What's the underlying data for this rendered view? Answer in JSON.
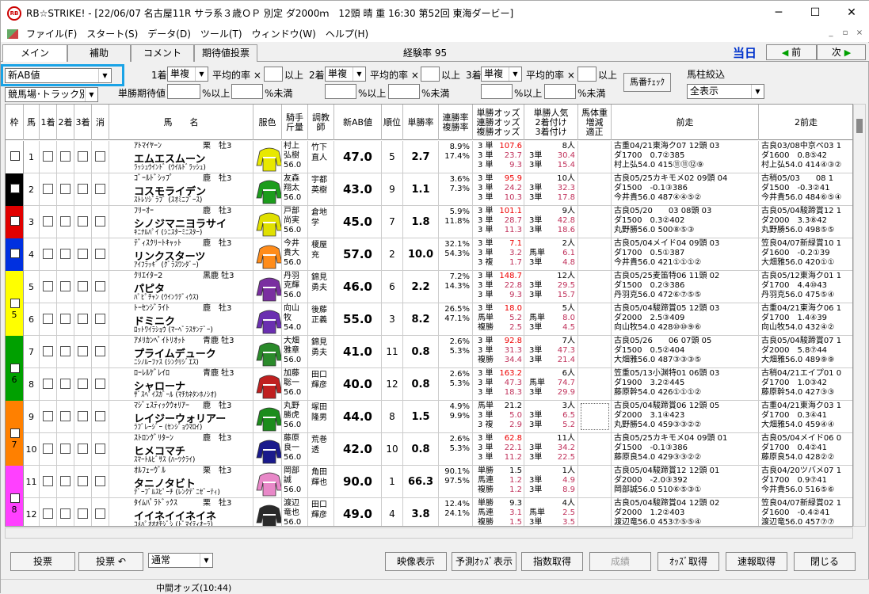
{
  "titlebar": {
    "title": "RB☆STRIKE! - [22/06/07 名古屋11R サラ系３歳ＯＰ 別定 ダ2000ｍ　12頭 晴 重 16:30 第52回 東海ダービー]",
    "minimize": "─",
    "maximize": "☐",
    "close": "✕",
    "icon": "RB"
  },
  "menu": [
    "ファイル(F)",
    "スタート(S)",
    "データ(D)",
    "ツール(T)",
    "ウィンドウ(W)",
    "ヘルプ(H)"
  ],
  "mdi": {
    "min": "_",
    "restore": "▫",
    "close": "×"
  },
  "tabs": [
    "メイン",
    "補助",
    "コメント",
    "期待値投票"
  ],
  "experience": "経験率 95",
  "today": "当日",
  "prev": "前",
  "next": "次",
  "controls": {
    "index": "新AB値",
    "venue": "競馬場･トラック別",
    "place1": "1着",
    "place2": "2着",
    "place3": "3着",
    "bet": "単複",
    "avg": "平均的率 ×",
    "above": "以上",
    "expect": "単勝期待値",
    "pct_above": "%以上",
    "pct_below": "%未満",
    "check_btn": "馬番ﾁｪｯｸ",
    "filter_label": "馬柱絞込",
    "filter": "全表示"
  },
  "columns": {
    "waku": "枠",
    "uma": "馬",
    "c1": "1着",
    "c2": "2着",
    "c3": "3着",
    "kesu": "消",
    "name": "馬　　名",
    "color": "服色",
    "jockey": "騎手\n斤量",
    "trainer": "調教\n師",
    "ab": "新AB値",
    "rank": "順位",
    "tan": "単勝率",
    "rate": "連勝率\n複勝率",
    "odds": "単勝オッズ\n連勝オッズ\n複勝オッズ",
    "pop": "単勝人気\n2着付け\n3着付け",
    "weight": "馬体重\n増減\n適正",
    "prev1": "前走",
    "prev2": "2前走"
  },
  "horses": [
    {
      "waku": "1",
      "no": "1",
      "sire": "ｱﾄﾏｲﾔｰﾝ",
      "sex": "栗　牡3",
      "name": "エムエスムーン",
      "dam": "ﾗｯｼｭｳｲﾝﾄﾞ (ｳｲﾙﾄﾞﾗｯｼｭ)",
      "j1": "村上",
      "j2": "弘樹",
      "wt": "56.0",
      "t1": "竹下",
      "t2": "直人",
      "ab": "47.0",
      "rank": "5",
      "tan": "2.7",
      "r1": "8.9%",
      "r2": "17.4%",
      "o1": "3 単",
      "o1v": "107.6",
      "o2": "3 単",
      "o2v": "23.7",
      "o3": "3 単",
      "o3v": "9.3",
      "p1": "8人",
      "p2l": "3単",
      "p2": "30.4",
      "p3l": "3単",
      "p3": "15.4",
      "pr1": "古重04/21東海ク07 12頭 03",
      "pr2": "ダ1700　0.7②385",
      "pr3": "村上弘54.0 415⑪⑪⑫⑨",
      "pp1": "古良03/08中京ペ03 1",
      "pp2": "ダ1600　0.8⑤42",
      "pp3": "村上弘54.0 414④③②"
    },
    {
      "waku": "2",
      "no": "2",
      "sire": "ｺﾞｰﾙﾄﾞｼｯﾌﾟ",
      "sex": "鹿　牡3",
      "name": "コスモライデン",
      "dam": "ｽﾄﾚｿｼﾞﾗﾌﾞ (ｽｵﾐﾆﾌﾞｰｽ)",
      "j1": "友森",
      "j2": "翔太",
      "wt": "56.0",
      "t1": "宇都",
      "t2": "英樹",
      "ab": "43.0",
      "rank": "9",
      "tan": "1.1",
      "r1": "3.6%",
      "r2": "7.3%",
      "o1": "3 単",
      "o1v": "95.9",
      "o2": "3 単",
      "o2v": "24.2",
      "o3": "3 単",
      "o3v": "10.3",
      "p1": "10人",
      "p2l": "3単",
      "p2": "32.3",
      "p3l": "3単",
      "p3": "17.8",
      "pr1": "古良05/25カキモメ02 09頭 04",
      "pr2": "ダ1500　-0.1③386",
      "pr3": "今井貴56.0 487④④⑤②",
      "pp1": "古稍05/03　　08 1",
      "pp2": "ダ1500　-0.3②41",
      "pp3": "今井貴56.0 484⑥⑤④"
    },
    {
      "waku": "3",
      "no": "3",
      "sire": "ﾌﾘｰｵｰ",
      "sex": "鹿　牡3",
      "name": "シノジマニヨラサイ",
      "dam": "ｷﾆﾅﾙﾊﾟｲ (ｼﾆｽﾀｰﾐﾆｽﾀｰ)",
      "j1": "戸部",
      "j2": "尚実",
      "wt": "56.0",
      "t1": "倉地",
      "t2": "学",
      "ab": "45.0",
      "rank": "7",
      "tan": "1.8",
      "r1": "5.9%",
      "r2": "11.8%",
      "o1": "3 単",
      "o1v": "101.1",
      "o2": "3 単",
      "o2v": "28.7",
      "o3": "3 単",
      "o3v": "11.3",
      "p1": "9人",
      "p2l": "3単",
      "p2": "42.8",
      "p3l": "3単",
      "p3": "18.6",
      "pr1": "古良05/20　　03 08頭 03",
      "pr2": "ダ1500　0.3②402",
      "pr3": "丸野勝56.0 500⑧⑤③",
      "pp1": "古良05/04駿蹄賞12 1",
      "pp2": "ダ2000　3.3⑧42",
      "pp3": "丸野勝56.0 498⑤⑤"
    },
    {
      "waku": "4",
      "no": "4",
      "sire": "ﾃﾞｨｽｸﾘｰﾄｷｬｯﾄ",
      "sex": "鹿　牡3",
      "name": "リンクスターツ",
      "dam": "ｱｲﾌﾗｯｷﾞ (ｸﾞﾗｽﾜﾝﾀﾞｰ)",
      "j1": "今井",
      "j2": "貴大",
      "wt": "56.0",
      "t1": "榎屋",
      "t2": "充",
      "ab": "57.0",
      "rank": "2",
      "tan": "10.0",
      "r1": "32.1%",
      "r2": "54.3%",
      "o1": "3 単",
      "o1v": "7.1",
      "o2": "3 単",
      "o2v": "3.2",
      "o3": "3 複",
      "o3v": "1.7",
      "p1": "2人",
      "p2l": "馬単",
      "p2": "6.1",
      "p3l": "3単",
      "p3": "4.8",
      "pr1": "古良05/04メイド04 09頭 03",
      "pr2": "ダ1700　0.5①387",
      "pr3": "今井貴56.0 421①①①②",
      "pp1": "笠良04/07新緑賞10 1",
      "pp2": "ダ1600　-0.2①39",
      "pp3": "大畑雅56.0 420①①"
    },
    {
      "waku": "5",
      "no": "5",
      "sire": "ｸﾘｴｲﾀｰ2",
      "sex": "黒鹿 牡3",
      "name": "パピタ",
      "dam": "ﾊﾟﾋﾟﾁｬﾝ (ｳｲﾝﾗﾃﾞｨｳｽ)",
      "j1": "丹羽",
      "j2": "克輝",
      "wt": "56.0",
      "t1": "錦見",
      "t2": "勇夫",
      "ab": "46.0",
      "rank": "6",
      "tan": "2.2",
      "r1": "7.2%",
      "r2": "14.3%",
      "o1": "3 単",
      "o1v": "148.7",
      "o2": "3 単",
      "o2v": "22.8",
      "o3": "3 単",
      "o3v": "9.3",
      "p1": "12人",
      "p2l": "3単",
      "p2": "29.5",
      "p3l": "3単",
      "p3": "15.7",
      "pr1": "古良05/25麦笛特06 11頭 02",
      "pr2": "ダ1500　0.2③386",
      "pr3": "丹羽克56.0 472⑥⑦⑤⑤",
      "pp1": "古良05/12東海ク01 1",
      "pp2": "ダ1700　4.4⑩43",
      "pp3": "丹羽克56.0 475⑤④"
    },
    {
      "waku": "5",
      "no": "6",
      "sire": "ﾄｰｾﾝｼﾞﾗｲﾄ",
      "sex": "鹿　牡3",
      "name": "ドミニク",
      "dam": "ﾛｯﾄﾜｲﾗｼｮｳ (ﾏｰﾍﾞﾗｽｻﾝﾃﾞｰ)",
      "j1": "向山",
      "j2": "牧",
      "wt": "54.0",
      "t1": "後藤",
      "t2": "正義",
      "ab": "55.0",
      "rank": "3",
      "tan": "8.2",
      "r1": "26.5%",
      "r2": "47.1%",
      "o1": "3 単",
      "o1v": "18.0",
      "o2": "馬単",
      "o2v": "5.2",
      "o3": "複勝",
      "o3v": "2.5",
      "p1": "5人",
      "p2l": "馬単",
      "p2": "8.0",
      "p3l": "3単",
      "p3": "4.5",
      "pr1": "古良05/04駿蹄賞05 12頭 03",
      "pr2": "ダ2000　2.5③409",
      "pr3": "向山牧54.0 428⑩⑩⑨⑥",
      "pp1": "古重04/21東海ク06 1",
      "pp2": "ダ1700　1.4④39",
      "pp3": "向山牧54.0 432④②"
    },
    {
      "waku": "6",
      "no": "7",
      "sire": "ｱﾒﾘｶﾝﾍﾟｲﾄﾘｵｯﾄ",
      "sex": "青鹿 牡3",
      "name": "プライムデューク",
      "dam": "ﾆｼﾉﾙｰﾌｧｽ (ｼﾝｸﾘｼﾞｴｽ)",
      "j1": "大畑",
      "j2": "雅章",
      "wt": "56.0",
      "t1": "錦見",
      "t2": "勇夫",
      "ab": "41.0",
      "rank": "11",
      "tan": "0.8",
      "r1": "2.6%",
      "r2": "5.3%",
      "o1": "3 単",
      "o1v": "92.8",
      "o2": "3 単",
      "o2v": "31.3",
      "o3": "複勝",
      "o3v": "34.4",
      "p1": "7人",
      "p2l": "3単",
      "p2": "47.3",
      "p3l": "3単",
      "p3": "21.4",
      "pr1": "古良05/26　　06 07頭 05",
      "pr2": "ダ1500　0.5②404",
      "pr3": "大畑雅56.0 487③③③⑤",
      "pp1": "古良05/04駿蹄賞07 1",
      "pp2": "ダ2000　5.8⑦44",
      "pp3": "大畑雅56.0 489⑨⑨"
    },
    {
      "waku": "6",
      "no": "8",
      "sire": "ﾛｰﾚﾙｹﾞﾚｲﾛ",
      "sex": "青鹿 牡3",
      "name": "シャローナ",
      "dam": "ｻﾞｽﾍﾟｲｽｶﾞｰﾙ (ﾏﾁｶﾈﾀﾝﾎﾉｼｵ)",
      "j1": "加藤",
      "j2": "聡一",
      "wt": "56.0",
      "t1": "田口",
      "t2": "輝彦",
      "ab": "40.0",
      "rank": "12",
      "tan": "0.8",
      "r1": "2.6%",
      "r2": "5.3%",
      "o1": "3 単",
      "o1v": "163.2",
      "o2": "3 単",
      "o2v": "47.3",
      "o3": "3 単",
      "o3v": "18.3",
      "p1": "6人",
      "p2l": "馬単",
      "p2": "74.7",
      "p3l": "3単",
      "p3": "29.9",
      "pr1": "笠重05/13小渊特01 06頭 03",
      "pr2": "ダ1900　3.2②445",
      "pr3": "藤原幹54.0 426①①①②",
      "pp1": "古稍04/21エイプ01 0",
      "pp2": "ダ1700　1.0③42",
      "pp3": "藤原幹54.0 427③③"
    },
    {
      "waku": "7",
      "no": "9",
      "sire": "ﾏｼﾞｪｽﾃｨｯｸｳｫﾘｱｰ",
      "sex": "鹿　牡3",
      "name": "レイジーウォリアー",
      "dam": "ﾗﾌﾞﾚｰｼﾞｰ (ｾﾝｼﾞｮｳﾏﾛｲ)",
      "j1": "丸野",
      "j2": "勝虎",
      "wt": "56.0",
      "t1": "塚田",
      "t2": "隆男",
      "ab": "44.0",
      "rank": "8",
      "tan": "1.5",
      "r1": "4.9%",
      "r2": "9.9%",
      "o1": "馬単",
      "o1v": "21.2",
      "o2": "3 単",
      "o2v": "5.0",
      "o3": "3 複",
      "o3v": "2.9",
      "p1": "3人",
      "p2l": "3単",
      "p2": "6.5",
      "p3l": "3単",
      "p3": "5.2",
      "pr1": "古良05/04駿蹄賞06 12頭 05",
      "pr2": "ダ2000　3.1④423",
      "pr3": "丸野勝54.0 459③③②②",
      "pp1": "古重04/21東海ク03 1",
      "pp2": "ダ1700　0.3④41",
      "pp3": "大畑雅54.0 459④④"
    },
    {
      "waku": "7",
      "no": "10",
      "sire": "ｽﾄﾛﾝｸﾞﾘﾀｰﾝ",
      "sex": "鹿　牡3",
      "name": "ヒメコマチ",
      "dam": "ｽﾏｰﾄﾙﾋﾞｻｽ (ﾊｰﾂｸﾗｲ)",
      "j1": "藤原",
      "j2": "良一",
      "wt": "56.0",
      "t1": "荒巻",
      "t2": "透",
      "ab": "42.0",
      "rank": "10",
      "tan": "0.8",
      "r1": "2.6%",
      "r2": "5.3%",
      "o1": "3 単",
      "o1v": "62.8",
      "o2": "3 単",
      "o2v": "22.1",
      "o3": "3 単",
      "o3v": "11.2",
      "p1": "11人",
      "p2l": "3単",
      "p2": "34.2",
      "p3l": "3単",
      "p3": "22.5",
      "pr1": "古良05/25カキモメ04 09頭 01",
      "pr2": "ダ1500　-0.1③386",
      "pr3": "藤原良54.0 429③③②②",
      "pp1": "古良05/04メイド06 0",
      "pp2": "ダ1700　0.4②41",
      "pp3": "藤原良54.0 428②②"
    },
    {
      "waku": "8",
      "no": "11",
      "sire": "ｵﾙﾌｪｰｳﾞﾙ",
      "sex": "栗　牡3",
      "name": "タニノタビト",
      "dam": "ﾃﾞｰﾌﾞﾙｽﾋﾟｰﾁ (ﾚﾝｸﾃﾞﾆｾﾞｰﾃｨ)",
      "j1": "岡部",
      "j2": "誠",
      "wt": "56.0",
      "t1": "角田",
      "t2": "輝也",
      "ab": "90.0",
      "rank": "1",
      "tan": "66.3",
      "r1": "90.1%",
      "r2": "97.5%",
      "o1": "単勝",
      "o1v": "1.5",
      "o2": "馬連",
      "o2v": "1.2",
      "o3": "複勝",
      "o3v": "1.2",
      "p1": "1人",
      "p2l": "3単",
      "p2": "4.9",
      "p3l": "3単",
      "p3": "8.9",
      "pr1": "古良05/04駿蹄賞12 12頭 01",
      "pr2": "ダ2000　-2.0③392",
      "pr3": "岡部誠56.0 510⑥⑤③①",
      "pp1": "古良04/20ツバメ07 1",
      "pp2": "ダ1700　0.9⑦41",
      "pp3": "今井貴56.0 516⑤⑥"
    },
    {
      "waku": "8",
      "no": "12",
      "sire": "ﾀｲﾑﾊﾟﾗﾄﾞｯｸｽ",
      "sex": "栗　牡3",
      "name": "イイネイイネイネ",
      "dam": "ｺﾒﾊﾟｵｵｵﾁｼﾞｼ (ﾄﾞﾏｲﾃｨｵｰﾗ)",
      "j1": "渡辺",
      "j2": "竜也",
      "wt": "56.0",
      "t1": "田口",
      "t2": "輝彦",
      "ab": "49.0",
      "rank": "4",
      "tan": "3.8",
      "r1": "12.4%",
      "r2": "24.1%",
      "o1": "単勝",
      "o1v": "9.3",
      "o2": "馬連",
      "o2v": "3.1",
      "o3": "複勝",
      "o3v": "1.5",
      "p1": "4人",
      "p2l": "馬単",
      "p2": "2.5",
      "p3l": "3単",
      "p3": "3.5",
      "pr1": "古良05/04駿蹄賞04 12頭 02",
      "pr2": "ダ2000　1.2②403",
      "pr3": "渡辺竜56.0 453⑦⑤⑤④",
      "pp1": "笠良04/07新緑賞02 1",
      "pp2": "ダ1600　-0.4②41",
      "pp3": "渡辺竜56.0 457⑦⑦"
    }
  ],
  "bottom_buttons": {
    "vote": "投票",
    "vote2": "投票 ↶",
    "mode": "通常",
    "video": "映像表示",
    "pred": "予測ｵｯｽﾞ表示",
    "index": "指数取得",
    "result": "成績",
    "odds": "ｵｯｽﾞ取得",
    "fast": "速報取得",
    "close": "閉じる"
  },
  "status": "中間オッズ(10:44)",
  "waku_colors": [
    "#ffffff",
    "#000000",
    "#e00000",
    "#0030e0",
    "#ffff00",
    "#00a000",
    "#ff8000",
    "#ff40ff"
  ]
}
